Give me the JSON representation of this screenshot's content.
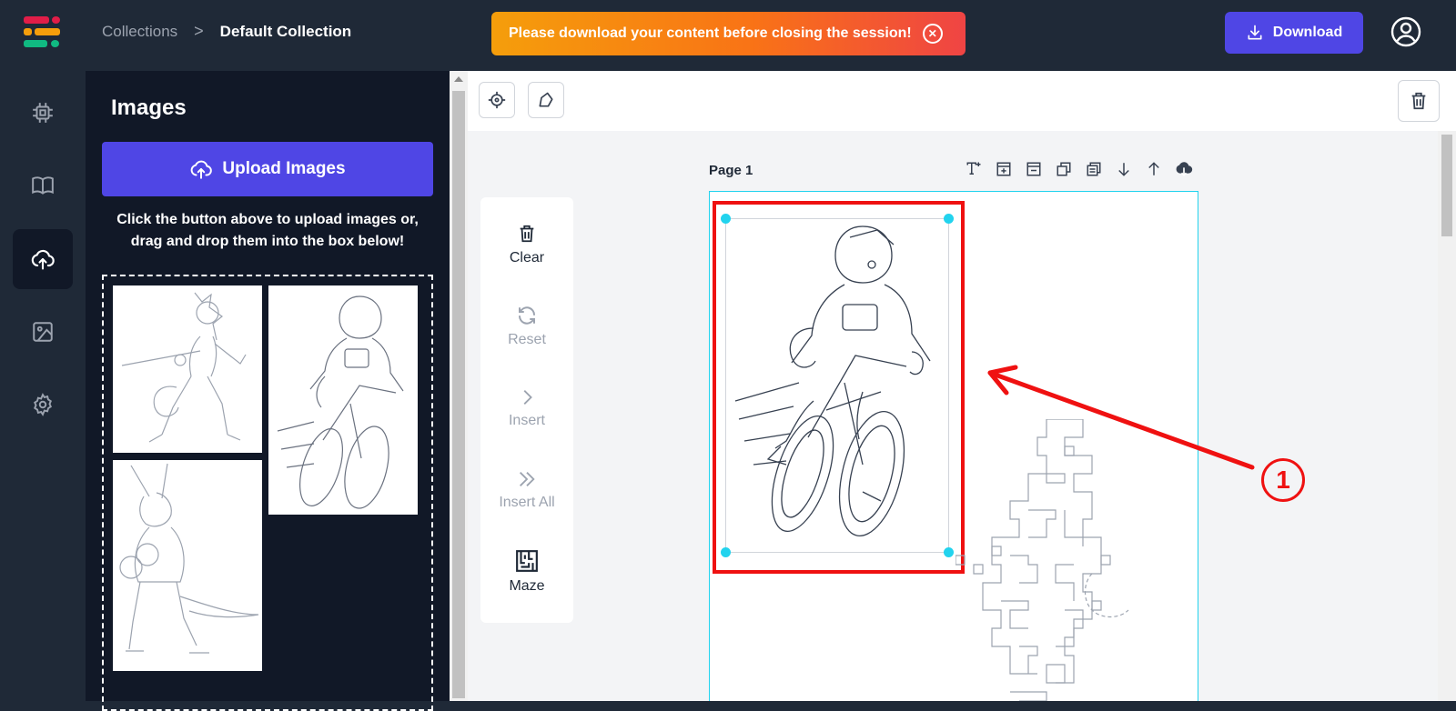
{
  "header": {
    "breadcrumb": {
      "root": "Collections",
      "separator": ">",
      "current": "Default Collection"
    },
    "notice": "Please download your content before closing the session!",
    "download_label": "Download"
  },
  "rail": {
    "items": [
      {
        "icon": "chip-icon",
        "active": false
      },
      {
        "icon": "book-icon",
        "active": false
      },
      {
        "icon": "cloud-upload-icon",
        "active": true
      },
      {
        "icon": "image-icon",
        "active": false
      },
      {
        "icon": "gear-icon",
        "active": false
      }
    ]
  },
  "panel": {
    "title": "Images",
    "upload_label": "Upload Images",
    "help_text": "Click the button above to upload images or, drag and drop them into the box below!",
    "thumbnails": [
      "hyena-fencer",
      "cheetah-cyclist",
      "kangaroo-boxer"
    ]
  },
  "canvas": {
    "side_tools": [
      {
        "label": "Clear",
        "icon": "trash-icon",
        "enabled": true
      },
      {
        "label": "Reset",
        "icon": "refresh-icon",
        "enabled": false
      },
      {
        "label": "Insert",
        "icon": "chevron-right-icon",
        "enabled": false
      },
      {
        "label": "Insert All",
        "icon": "double-chevron-right-icon",
        "enabled": false
      },
      {
        "label": "Maze",
        "icon": "maze-icon",
        "enabled": true
      }
    ],
    "page_label": "Page 1",
    "page_tools": [
      "add-text-icon",
      "add-page-icon",
      "remove-page-icon",
      "duplicate-icon",
      "copy-page-icon",
      "move-down-icon",
      "move-up-icon",
      "cloud-download-icon"
    ]
  },
  "annotation": {
    "number": "1",
    "color": "#ef1111"
  },
  "colors": {
    "accent": "#4f46e5",
    "selection": "#22d3ee",
    "background": "#1f2937",
    "panel": "#111827"
  }
}
